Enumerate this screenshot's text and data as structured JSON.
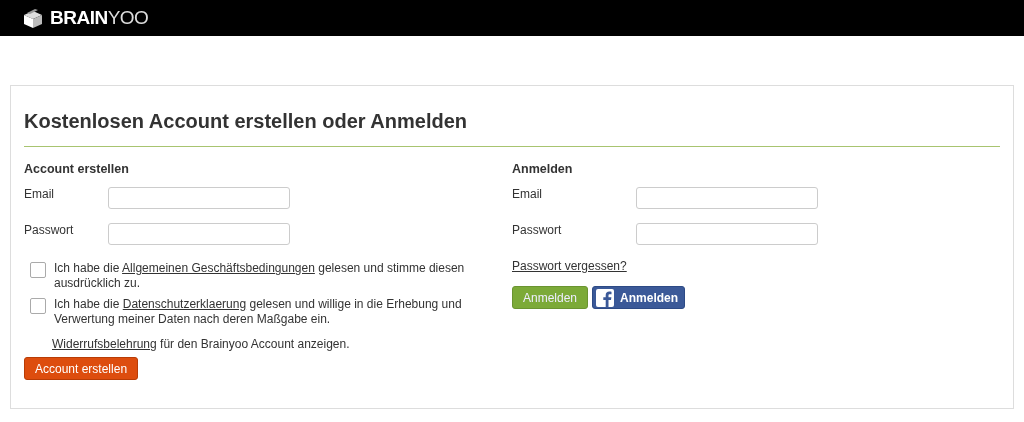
{
  "header": {
    "logo": "**BRAIN**YOO"
  },
  "card": {
    "title": "Kostenlosen Account erstellen oder Anmelden"
  },
  "register": {
    "heading": "Account erstellen",
    "fields": [
      {
        "label": "Email"
      },
      {
        "label": "Passwort"
      }
    ],
    "consents": [
      {
        "before": "Ich habe die ",
        "link": "Allgemeinen Geschäftsbedingungen",
        "after": " gelesen und stimme diesen ausdrücklich zu.",
        "checked": false
      },
      {
        "before": "Ich habe die ",
        "link": "Datenschutzerklaerung",
        "after": " gelesen und willige in die Erhebung und Verwertung meiner Daten nach deren Maßgabe ein.",
        "checked": false
      }
    ],
    "revocation": {
      "link": "Widerrufsbelehrung",
      "after": " für den Brainyoo Account anzeigen."
    },
    "button": "Account erstellen"
  },
  "login": {
    "heading": "Anmelden",
    "fields": [
      {
        "label": "Email"
      },
      {
        "label": "Passwort"
      }
    ],
    "forgot": "Passwort vergessen?",
    "buttons": [
      {
        "label": "Anmelden",
        "kind": "plain"
      },
      {
        "label": "Anmelden",
        "kind": "facebook"
      }
    ]
  }
}
